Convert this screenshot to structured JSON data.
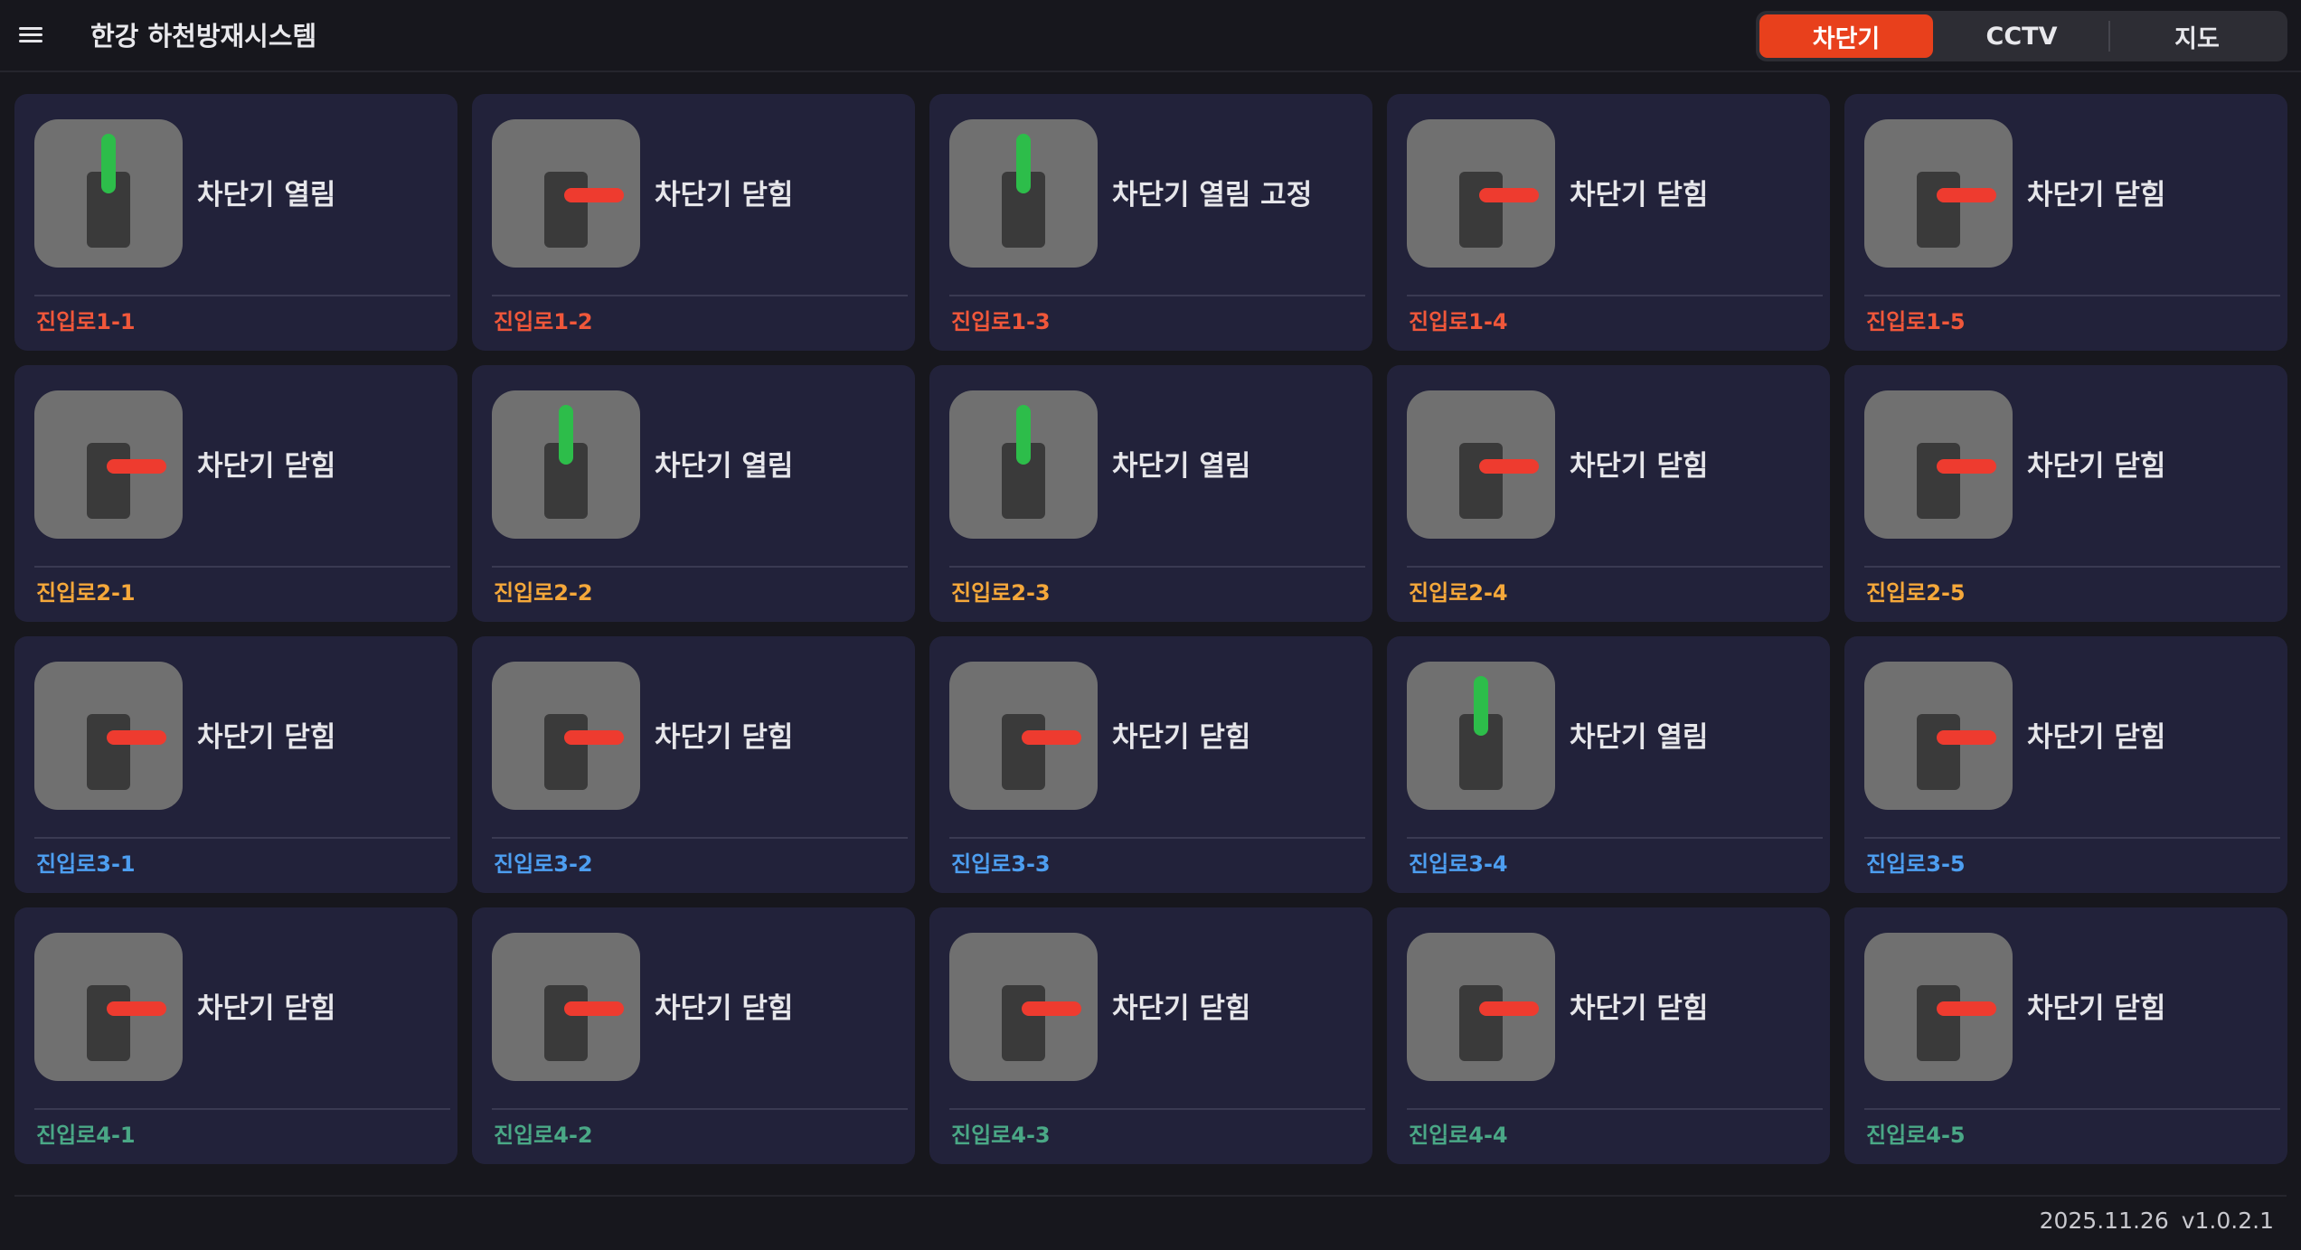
{
  "header": {
    "title": "한강 하천방재시스템",
    "menu_icon": "hamburger-menu-icon",
    "tabs": [
      {
        "label": "차단기",
        "active": true
      },
      {
        "label": "CCTV",
        "active": false
      },
      {
        "label": "지도",
        "active": false
      }
    ]
  },
  "colors": {
    "accent": "#e8401c",
    "arm_open": "#2dbd4a",
    "arm_closed": "#ee3b2f",
    "row_label_colors": [
      "#f0573a",
      "#f5a83a",
      "#4d9ef0",
      "#4aa886"
    ]
  },
  "cards": [
    {
      "status": "차단기 열림",
      "state": "open",
      "label": "진입로1-1",
      "group": 0
    },
    {
      "status": "차단기 닫힘",
      "state": "closed",
      "label": "진입로1-2",
      "group": 0
    },
    {
      "status": "차단기 열림 고정",
      "state": "open",
      "label": "진입로1-3",
      "group": 0
    },
    {
      "status": "차단기 닫힘",
      "state": "closed",
      "label": "진입로1-4",
      "group": 0
    },
    {
      "status": "차단기 닫힘",
      "state": "closed",
      "label": "진입로1-5",
      "group": 0
    },
    {
      "status": "차단기 닫힘",
      "state": "closed",
      "label": "진입로2-1",
      "group": 1
    },
    {
      "status": "차단기 열림",
      "state": "open",
      "label": "진입로2-2",
      "group": 1
    },
    {
      "status": "차단기 열림",
      "state": "open",
      "label": "진입로2-3",
      "group": 1
    },
    {
      "status": "차단기 닫힘",
      "state": "closed",
      "label": "진입로2-4",
      "group": 1
    },
    {
      "status": "차단기 닫힘",
      "state": "closed",
      "label": "진입로2-5",
      "group": 1
    },
    {
      "status": "차단기 닫힘",
      "state": "closed",
      "label": "진입로3-1",
      "group": 2
    },
    {
      "status": "차단기 닫힘",
      "state": "closed",
      "label": "진입로3-2",
      "group": 2
    },
    {
      "status": "차단기 닫힘",
      "state": "closed",
      "label": "진입로3-3",
      "group": 2
    },
    {
      "status": "차단기 열림",
      "state": "open",
      "label": "진입로3-4",
      "group": 2
    },
    {
      "status": "차단기 닫힘",
      "state": "closed",
      "label": "진입로3-5",
      "group": 2
    },
    {
      "status": "차단기 닫힘",
      "state": "closed",
      "label": "진입로4-1",
      "group": 3
    },
    {
      "status": "차단기 닫힘",
      "state": "closed",
      "label": "진입로4-2",
      "group": 3
    },
    {
      "status": "차단기 닫힘",
      "state": "closed",
      "label": "진입로4-3",
      "group": 3
    },
    {
      "status": "차단기 닫힘",
      "state": "closed",
      "label": "진입로4-4",
      "group": 3
    },
    {
      "status": "차단기 닫힘",
      "state": "closed",
      "label": "진입로4-5",
      "group": 3
    }
  ],
  "footer": {
    "date": "2025.11.26",
    "version": "v1.0.2.1"
  }
}
